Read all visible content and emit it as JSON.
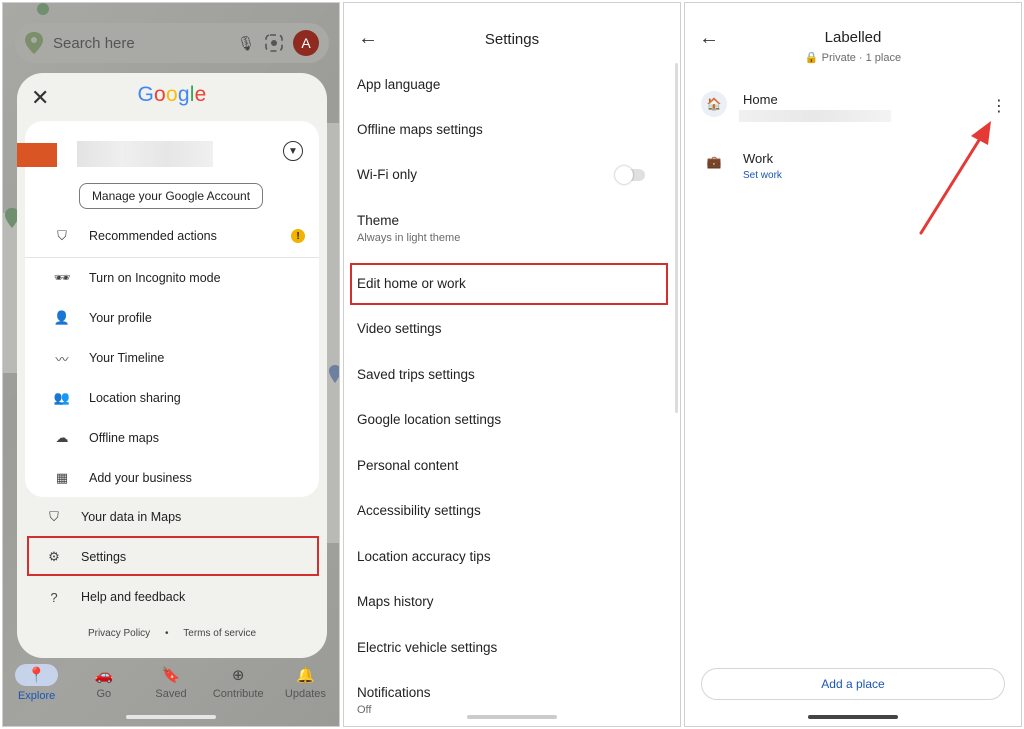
{
  "panel1": {
    "search_placeholder": "Search here",
    "avatar_letter": "A",
    "brand": [
      {
        "ch": "G",
        "color": "#4285F4"
      },
      {
        "ch": "o",
        "color": "#EA4335"
      },
      {
        "ch": "o",
        "color": "#FBBC05"
      },
      {
        "ch": "g",
        "color": "#4285F4"
      },
      {
        "ch": "l",
        "color": "#34A853"
      },
      {
        "ch": "e",
        "color": "#EA4335"
      }
    ],
    "manage_account": "Manage your Google Account",
    "menu": [
      {
        "label": "Recommended actions",
        "icon": "shield-google-icon"
      },
      {
        "label": "Turn on Incognito mode",
        "icon": "incognito-icon"
      },
      {
        "label": "Your profile",
        "icon": "person-icon"
      },
      {
        "label": "Your Timeline",
        "icon": "timeline-icon"
      },
      {
        "label": "Location sharing",
        "icon": "location-sharing-icon"
      },
      {
        "label": "Offline maps",
        "icon": "offline-cloud-icon"
      },
      {
        "label": "Add your business",
        "icon": "storefront-icon"
      },
      {
        "label": "Your data in Maps",
        "icon": "data-shield-icon"
      },
      {
        "label": "Settings",
        "icon": "gear-icon"
      },
      {
        "label": "Help and feedback",
        "icon": "help-icon"
      }
    ],
    "footer": {
      "privacy": "Privacy Policy",
      "separator": "•",
      "terms": "Terms of service"
    },
    "bottom_nav": [
      {
        "label": "Explore",
        "icon": "explore-pin-icon"
      },
      {
        "label": "Go",
        "icon": "car-icon"
      },
      {
        "label": "Saved",
        "icon": "bookmark-icon"
      },
      {
        "label": "Contribute",
        "icon": "plus-circle-icon"
      },
      {
        "label": "Updates",
        "icon": "bell-icon"
      }
    ],
    "accent": "#d32f2f"
  },
  "panel2": {
    "title": "Settings",
    "items": [
      {
        "label": "App language",
        "sub": ""
      },
      {
        "label": "Offline maps settings",
        "sub": ""
      },
      {
        "label": "Wi-Fi only",
        "sub": ""
      },
      {
        "label": "Theme",
        "sub": "Always in light theme"
      },
      {
        "label": "Edit home or work",
        "sub": ""
      },
      {
        "label": "Video settings",
        "sub": ""
      },
      {
        "label": "Saved trips settings",
        "sub": ""
      },
      {
        "label": "Google location settings",
        "sub": ""
      },
      {
        "label": "Personal content",
        "sub": ""
      },
      {
        "label": "Accessibility settings",
        "sub": ""
      },
      {
        "label": "Location accuracy tips",
        "sub": ""
      },
      {
        "label": "Maps history",
        "sub": ""
      },
      {
        "label": "Electric vehicle settings",
        "sub": ""
      },
      {
        "label": "Notifications",
        "sub": "Off"
      }
    ],
    "wifi_only_on": false
  },
  "panel3": {
    "title": "Labelled",
    "subtitle": "🔒 Private · 1 place",
    "home_label": "Home",
    "work_label": "Work",
    "set_work": "Set work",
    "add_place": "Add a place",
    "link_color": "#1a56b3"
  }
}
